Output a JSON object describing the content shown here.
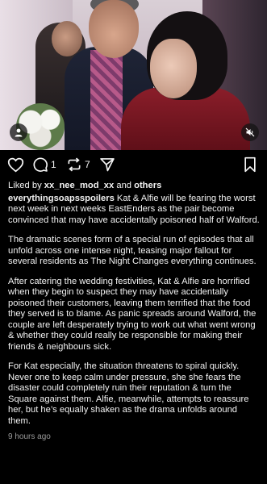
{
  "post": {
    "likes_prefix": "Liked by ",
    "liked_by_user": "xx_nee_mod_xx",
    "likes_middle": " and ",
    "likes_others": "others",
    "username": "everythingsoapsspoilers",
    "paragraphs": [
      " Kat & Alfie will be fearing the worst next week in next weeks EastEnders as the pair become convinced that may have accidentally poisoned half of Walford.",
      "The dramatic scenes form of a special run of episodes that all unfold across one intense night, teasing major fallout for several residents as The Night Changes everything continues.",
      "After catering the wedding festivities, Kat & Alfie are horrified when they begin to suspect they may have accidentally poisoned their customers, leaving them terrified that the food they served is to blame. As panic spreads around Walford, the couple are left desperately trying to work out what went wrong & whether they could really be responsible for making their friends & neighbours sick.",
      "For Kat especially, the situation threatens to spiral quickly. Never one to keep calm under pressure, she she fears the disaster could completely ruin their reputation & turn the Square against them. Alfie, meanwhile, attempts to reassure her, but he’s equally shaken as the drama unfolds around them."
    ],
    "timestamp": "9 hours ago"
  },
  "actions": {
    "comment_count": "1",
    "repost_count": "7"
  },
  "icons": {
    "like": "heart-icon",
    "comment": "comment-icon",
    "repost": "repost-icon",
    "share": "send-icon",
    "save": "bookmark-icon",
    "tag": "user-tag-icon",
    "mute": "speaker-muted-icon"
  },
  "colors": {
    "background": "#000000",
    "text": "#f2f2f2",
    "muted": "#9a9a9a"
  }
}
